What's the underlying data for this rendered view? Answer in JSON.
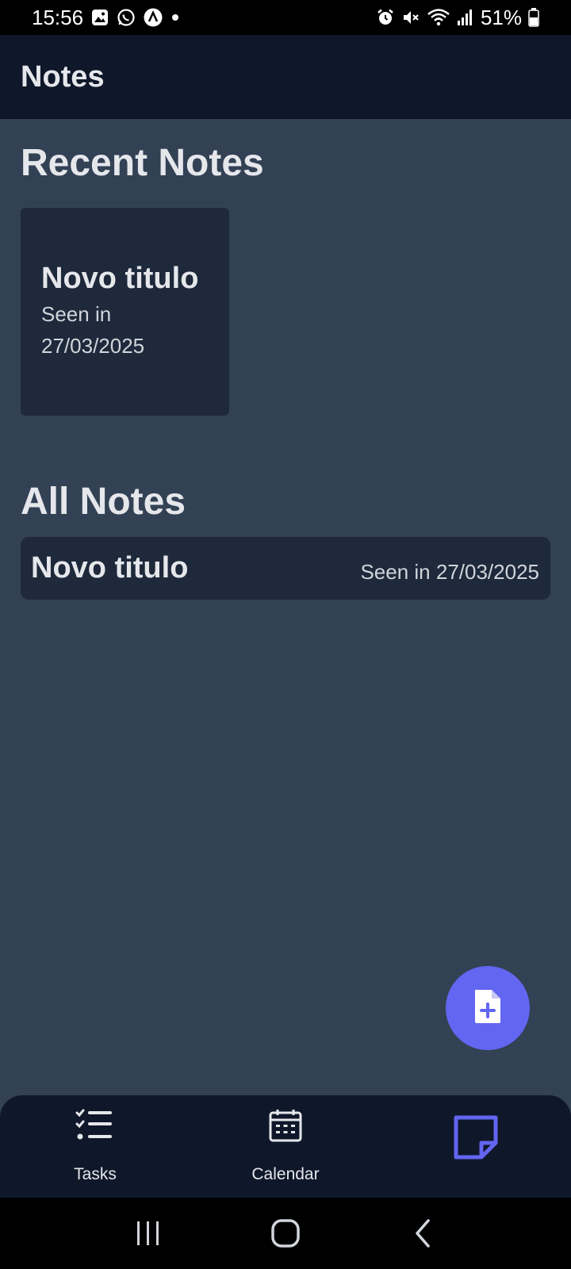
{
  "status_bar": {
    "time": "15:56",
    "battery": "51%",
    "left_icons": [
      "gallery-icon",
      "whatsapp-icon",
      "app-icon",
      "dot-icon"
    ],
    "right_icons": [
      "alarm-icon",
      "mute-icon",
      "wifi-icon",
      "signal-icon",
      "battery-icon"
    ]
  },
  "app_bar": {
    "title": "Notes"
  },
  "recent": {
    "title": "Recent Notes",
    "cards": [
      {
        "title": "Novo titulo",
        "subtitle": "Seen in 27/03/2025"
      }
    ]
  },
  "all": {
    "title": "All Notes",
    "items": [
      {
        "title": "Novo titulo",
        "date": "Seen in 27/03/2025"
      }
    ]
  },
  "fab": {
    "icon": "add-note-icon"
  },
  "bottom_nav": {
    "items": [
      {
        "label": "Tasks",
        "icon": "tasks-list-icon"
      },
      {
        "label": "Calendar",
        "icon": "calendar-icon"
      },
      {
        "label": "",
        "icon": "note-icon",
        "active": true
      }
    ]
  },
  "system_nav": {
    "buttons": [
      "recents-icon",
      "home-icon",
      "back-icon"
    ]
  },
  "colors": {
    "background": "#334155",
    "surface": "#1e293b",
    "bar": "#0f172a",
    "accent": "#6366f1"
  }
}
